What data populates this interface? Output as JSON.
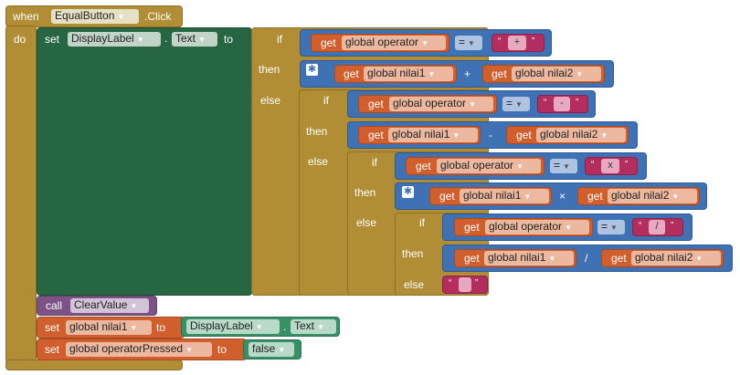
{
  "event": {
    "when_label": "when",
    "component": "EqualButton",
    "event_name": ".Click",
    "do_label": "do"
  },
  "set_display": {
    "set_label": "set",
    "component": "DisplayLabel",
    "dot": ".",
    "property": "Text",
    "to_label": "to"
  },
  "ifelse": {
    "if_label": "if",
    "then_label": "then",
    "else_label": "else"
  },
  "get_label": "get",
  "vars": {
    "operator": "global operator",
    "nilai1": "global nilai1",
    "nilai2": "global nilai2",
    "operatorPressed": "global operatorPressed"
  },
  "compare_op": "=",
  "ops": {
    "plus": "+",
    "minus": "-",
    "times": "×",
    "divide": "/"
  },
  "strings": {
    "plus": "+",
    "minus": "-",
    "times": "x",
    "divide": "/",
    "empty": " "
  },
  "quote_open": "“",
  "quote_close": "”",
  "call": {
    "call_label": "call",
    "procedure": "ClearValue"
  },
  "set_nilai1": {
    "set_label": "set",
    "variable": "global nilai1",
    "to_label": "to",
    "component": "DisplayLabel",
    "dot": ".",
    "property": "Text"
  },
  "set_opPressed": {
    "set_label": "set",
    "variable": "global operatorPressed",
    "to_label": "to",
    "value": "false"
  },
  "colors": {
    "event": "#b18e35",
    "setter": "#266643",
    "control": "#b18e35",
    "math": "#3f71b5",
    "variable": "#d05f2d",
    "text": "#b32d5e",
    "procedure": "#7c5385",
    "logic": "#389067"
  },
  "icons": {
    "dropdown": "triangle-down",
    "mutator": "gear-icon"
  }
}
